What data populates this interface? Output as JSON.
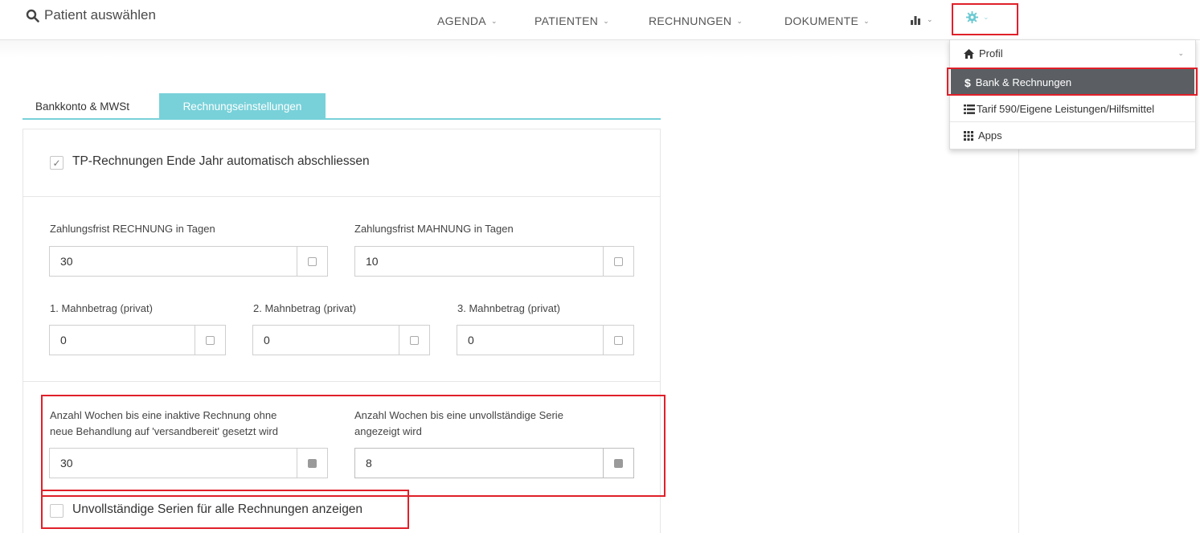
{
  "header": {
    "patient_search": "Patient auswählen",
    "nav": [
      {
        "label": "AGENDA"
      },
      {
        "label": "PATIENTEN"
      },
      {
        "label": "RECHNUNGEN"
      },
      {
        "label": "DOKUMENTE"
      }
    ],
    "stats_icon": "bar-chart-icon",
    "settings_icon": "gear-icon"
  },
  "dropdown": {
    "items": [
      {
        "label": "Profil",
        "icon": "home-icon"
      },
      {
        "label": "Bank & Rechnungen",
        "icon": "dollar-icon"
      },
      {
        "label": "Tarif 590/Eigene Leistungen/Hilfsmittel",
        "icon": "list-icon"
      },
      {
        "label": "Apps",
        "icon": "grid-icon"
      }
    ]
  },
  "tabs": [
    {
      "label": "Bankkonto & MWSt"
    },
    {
      "label": "Rechnungseinstellungen"
    }
  ],
  "form": {
    "tp_auto_close": {
      "label": "TP-Rechnungen Ende Jahr automatisch abschliessen",
      "checked": true
    },
    "zahlungsfrist_rechnung": {
      "label": "Zahlungsfrist RECHNUNG in Tagen",
      "value": "30"
    },
    "zahlungsfrist_mahnung": {
      "label": "Zahlungsfrist MAHNUNG in Tagen",
      "value": "10"
    },
    "mahnbetrag_1": {
      "label": "1. Mahnbetrag (privat)",
      "value": "0"
    },
    "mahnbetrag_2": {
      "label": "2. Mahnbetrag (privat)",
      "value": "0"
    },
    "mahnbetrag_3": {
      "label": "3. Mahnbetrag (privat)",
      "value": "0"
    },
    "wochen_inaktiv": {
      "label_line1": "Anzahl Wochen bis eine inaktive Rechnung ohne",
      "label_line2": "neue Behandlung auf 'versandbereit' gesetzt wird",
      "value": "30"
    },
    "wochen_serie": {
      "label_line1": "Anzahl Wochen bis eine unvollständige Serie",
      "label_line2": "angezeigt wird",
      "value": "8"
    },
    "unvollstaendige_serien": {
      "label": "Unvollständige Serien für alle Rechnungen anzeigen",
      "checked": false
    }
  },
  "colors": {
    "accent": "#78d1d9",
    "highlight": "#e0202a",
    "active_menu": "#5b5f63"
  }
}
